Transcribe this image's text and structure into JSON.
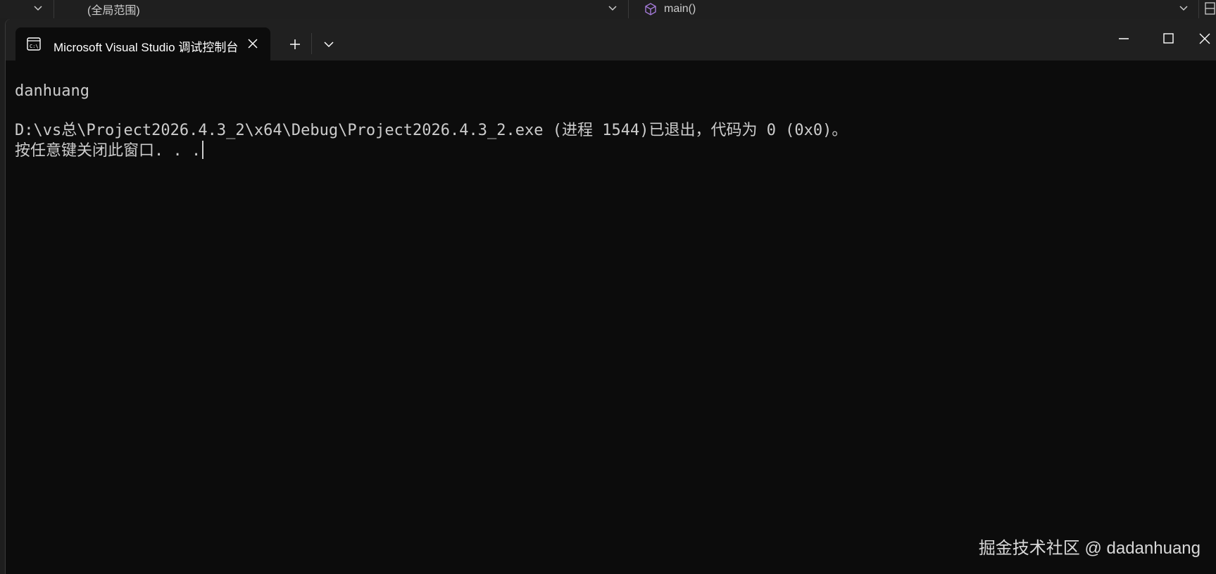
{
  "vs_navbar": {
    "scope_label": "(全局范围)",
    "function_label": "main()"
  },
  "terminal": {
    "tab_title": "Microsoft Visual Studio 调试控制台",
    "console_lines": [
      "danhuang",
      "",
      "D:\\vs总\\Project2026.4.3_2\\x64\\Debug\\Project2026.4.3_2.exe (进程 1544)已退出，代码为 0 (0x0)。",
      "按任意键关闭此窗口. . ."
    ]
  },
  "watermark": "掘金技术社区 @ dadanhuang",
  "icons": {
    "tab_icon": "console-icon",
    "tab_close": "close-icon",
    "new_tab": "plus-icon",
    "tab_dropdown": "chevron-down-icon",
    "minimize": "minimize-icon",
    "maximize": "maximize-icon",
    "close_window": "close-icon",
    "function_icon": "cube-icon"
  },
  "colors": {
    "console_bg": "#0c0c0c",
    "console_fg": "#cccccc",
    "titlebar_bg": "#202020",
    "navbar_bg": "#1f1f1f"
  }
}
